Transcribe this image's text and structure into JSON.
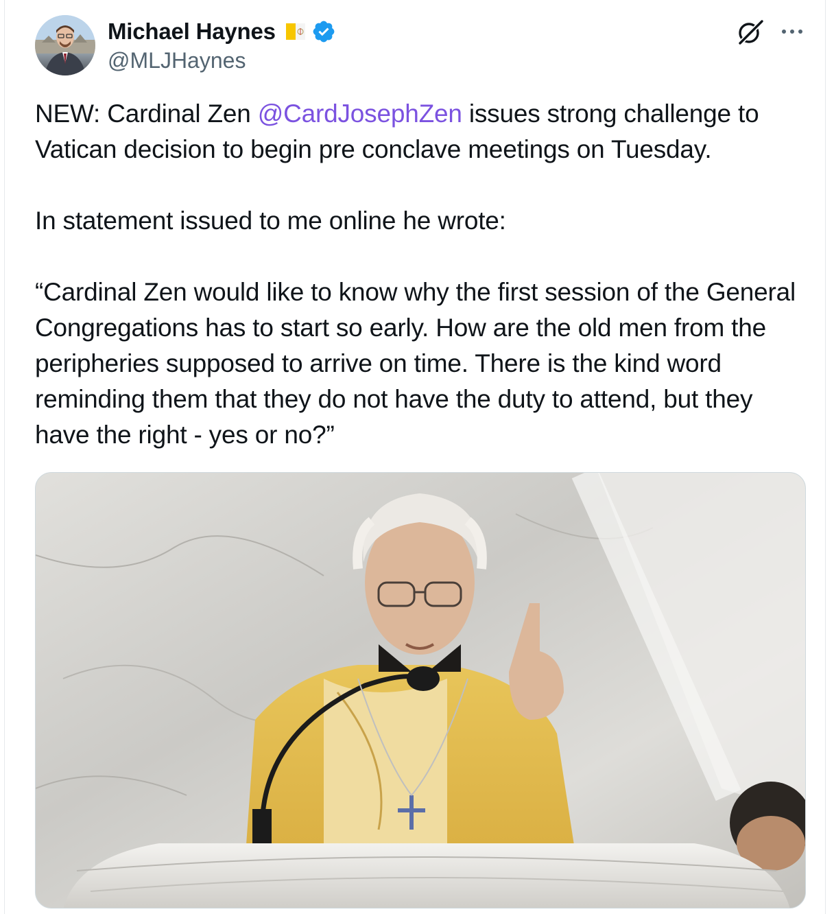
{
  "author": {
    "display_name": "Michael Haynes",
    "handle": "@MLJHaynes",
    "flag_icon": "vatican-flag-emoji",
    "verified": true,
    "verified_color": "#1d9bf0"
  },
  "tweet": {
    "prefix": "NEW: Cardinal Zen ",
    "mention": "@CardJosephZen",
    "line1_rest": " issues strong challenge to Vatican decision to begin pre conclave meetings on Tuesday.",
    "paragraph2": "In statement issued to me online he wrote:",
    "quote": "“Cardinal Zen would like to know why the first session of the General Congregations has to start so early. How are the old men from the peripheries supposed to arrive on time. There is the kind word reminding them that they do not have the duty to attend, but they have the right - yes or no?”"
  },
  "icons": {
    "grok": "grok-icon",
    "more": "more-options-icon"
  },
  "colors": {
    "text": "#0f1419",
    "secondary": "#536471",
    "mention": "#7b52e0"
  }
}
